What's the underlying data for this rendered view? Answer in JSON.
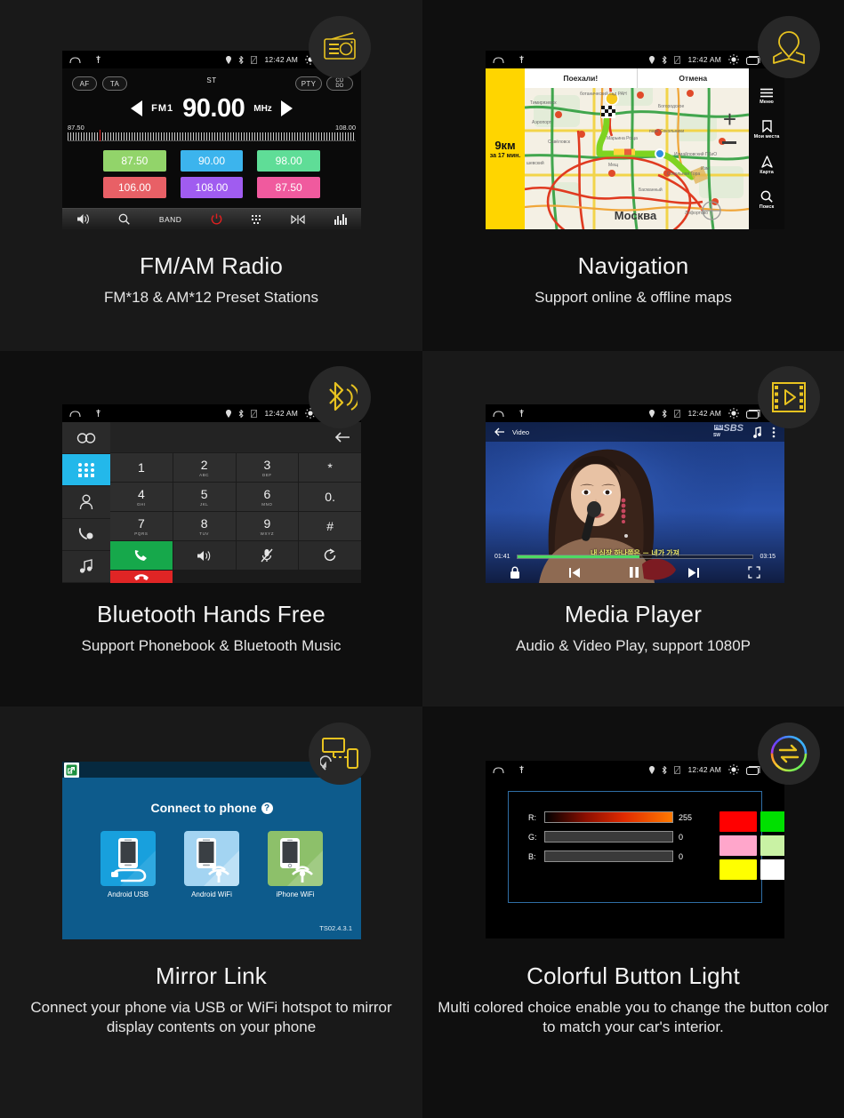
{
  "statusbar": {
    "time": "12:42 AM",
    "icons": [
      "home-icon",
      "pin-icon",
      "location-icon",
      "bluetooth-icon",
      "sim-icon",
      "brightness-icon",
      "recents-icon",
      "back-icon"
    ]
  },
  "panels": [
    {
      "id": "radio",
      "badge_icon": "radio-icon",
      "title": "FM/AM Radio",
      "subtitle": "FM*18 & AM*12 Preset Stations",
      "screen": {
        "af_label": "AF",
        "ta_label": "TA",
        "pty_label": "PTY",
        "cd_label_1": "CD",
        "cd_label_2": "DD",
        "st_label": "ST",
        "band_label": "FM1",
        "frequency": "90.00",
        "unit": "MHz",
        "scale_low": "87.50",
        "scale_high": "108.00",
        "presets": [
          {
            "value": "87.50",
            "color": "#92d46a"
          },
          {
            "value": "90.00",
            "color": "#3cb4ed"
          },
          {
            "value": "98.00",
            "color": "#5fdd97"
          },
          {
            "value": "106.00",
            "color": "#e86066"
          },
          {
            "value": "108.00",
            "color": "#a05cf0"
          },
          {
            "value": "87.50",
            "color": "#f05a9e"
          }
        ],
        "bottombar": [
          "volume-icon",
          "search-icon",
          "BAND",
          "power-icon",
          "keypad-icon",
          "shuffle-icon",
          "equalizer-icon"
        ],
        "band_button": "BAND"
      }
    },
    {
      "id": "navigation",
      "badge_icon": "map-pin-icon",
      "title": "Navigation",
      "subtitle": "Support online & offline maps",
      "screen": {
        "go_button": "Поехали!",
        "cancel_button": "Отмена",
        "distance": "9км",
        "eta": "за 17 мин.",
        "city": "Москва",
        "rail": [
          {
            "icon": "menu-icon",
            "label": "Меню"
          },
          {
            "icon": "bookmark-icon",
            "label": "Мои места"
          },
          {
            "icon": "compass-icon",
            "label": "Карта"
          },
          {
            "icon": "search-icon",
            "label": "Поиск"
          }
        ],
        "map_labels": [
          "Тимирязевск",
          "ботанический сад РАН",
          "Богородское",
          "Аэропорт",
          "Савёловск",
          "парк Сокольники",
          "Марьина Роща",
          "Измайловский ПКиО",
          "Сокольная Гора",
          "шевский",
          "Мещ",
          "Изм",
          "Басманный",
          "Лефортово"
        ],
        "zoom_in": "+",
        "zoom_out": "−"
      }
    },
    {
      "id": "bluetooth",
      "badge_icon": "bluetooth-icon",
      "title": "Bluetooth Hands Free",
      "subtitle": "Support Phonebook & Bluetooth Music",
      "screen": {
        "rail": [
          "link-icon",
          "keypad-icon",
          "contacts-icon",
          "call-history-icon",
          "music-note-icon"
        ],
        "backspace": "backspace-icon",
        "keys": [
          {
            "num": "1",
            "sub": ""
          },
          {
            "num": "2",
            "sub": "ABC"
          },
          {
            "num": "3",
            "sub": "DEF"
          },
          {
            "num": "*",
            "sub": ""
          },
          {
            "num": "4",
            "sub": "GHI"
          },
          {
            "num": "5",
            "sub": "JKL"
          },
          {
            "num": "6",
            "sub": "MNO"
          },
          {
            "num": "0.",
            "sub": ""
          },
          {
            "num": "7",
            "sub": "PQRS"
          },
          {
            "num": "8",
            "sub": "TUV"
          },
          {
            "num": "9",
            "sub": "WXYZ"
          },
          {
            "num": "#",
            "sub": ""
          }
        ],
        "action_keys": [
          "call-icon",
          "speaker-icon",
          "mic-mute-icon",
          "transfer-icon",
          "hangup-icon"
        ]
      }
    },
    {
      "id": "media",
      "badge_icon": "video-film-icon",
      "title": "Media Player",
      "subtitle": "Audio & Video Play, support 1080P",
      "screen": {
        "back": "back-arrow-icon",
        "tab": "Video",
        "channel_logo": "SBS",
        "channel_hd": "HD",
        "channel_sw": "SW",
        "subtitle_text": "내 심장 하나쯤은 － 네가 가져",
        "time_elapsed": "01:41",
        "time_total": "03:15",
        "progress_percent": 52,
        "controls": [
          "lock-icon",
          "prev-icon",
          "pause-icon",
          "next-icon",
          "fullscreen-icon"
        ]
      }
    },
    {
      "id": "mirror",
      "badge_icon": "screen-mirror-icon",
      "title": "Mirror Link",
      "subtitle": "Connect your phone via USB or WiFi hotspot to mirror display contents on your phone",
      "screen": {
        "app_icon": "mirror-app-icon",
        "back_icon": "back-arrow-icon",
        "heading": "Connect to phone",
        "help": "?",
        "options": [
          {
            "label": "Android USB",
            "color": "#18a0dd"
          },
          {
            "label": "Android WiFi",
            "color": "#a3d4f2"
          },
          {
            "label": "iPhone WiFi",
            "color": "#8dc06a"
          }
        ],
        "version": "TS02.4.3.1"
      }
    },
    {
      "id": "color",
      "badge_icon": "color-wheel-swap-icon",
      "title": "Colorful Button Light",
      "subtitle": "Multi colored choice enable you to change the button color to match your car's interior.",
      "screen": {
        "channels": [
          {
            "label": "R:",
            "value": "255",
            "filled": true
          },
          {
            "label": "G:",
            "value": "0",
            "filled": false
          },
          {
            "label": "B:",
            "value": "0",
            "filled": false
          }
        ],
        "swatches": [
          "#ff0000",
          "#00e000",
          "#0000ee",
          "#ffa6cb",
          "#c9f2a4",
          "#82cdf5",
          "#ffff00",
          "#ffffff",
          "#ff6a00"
        ]
      }
    }
  ]
}
